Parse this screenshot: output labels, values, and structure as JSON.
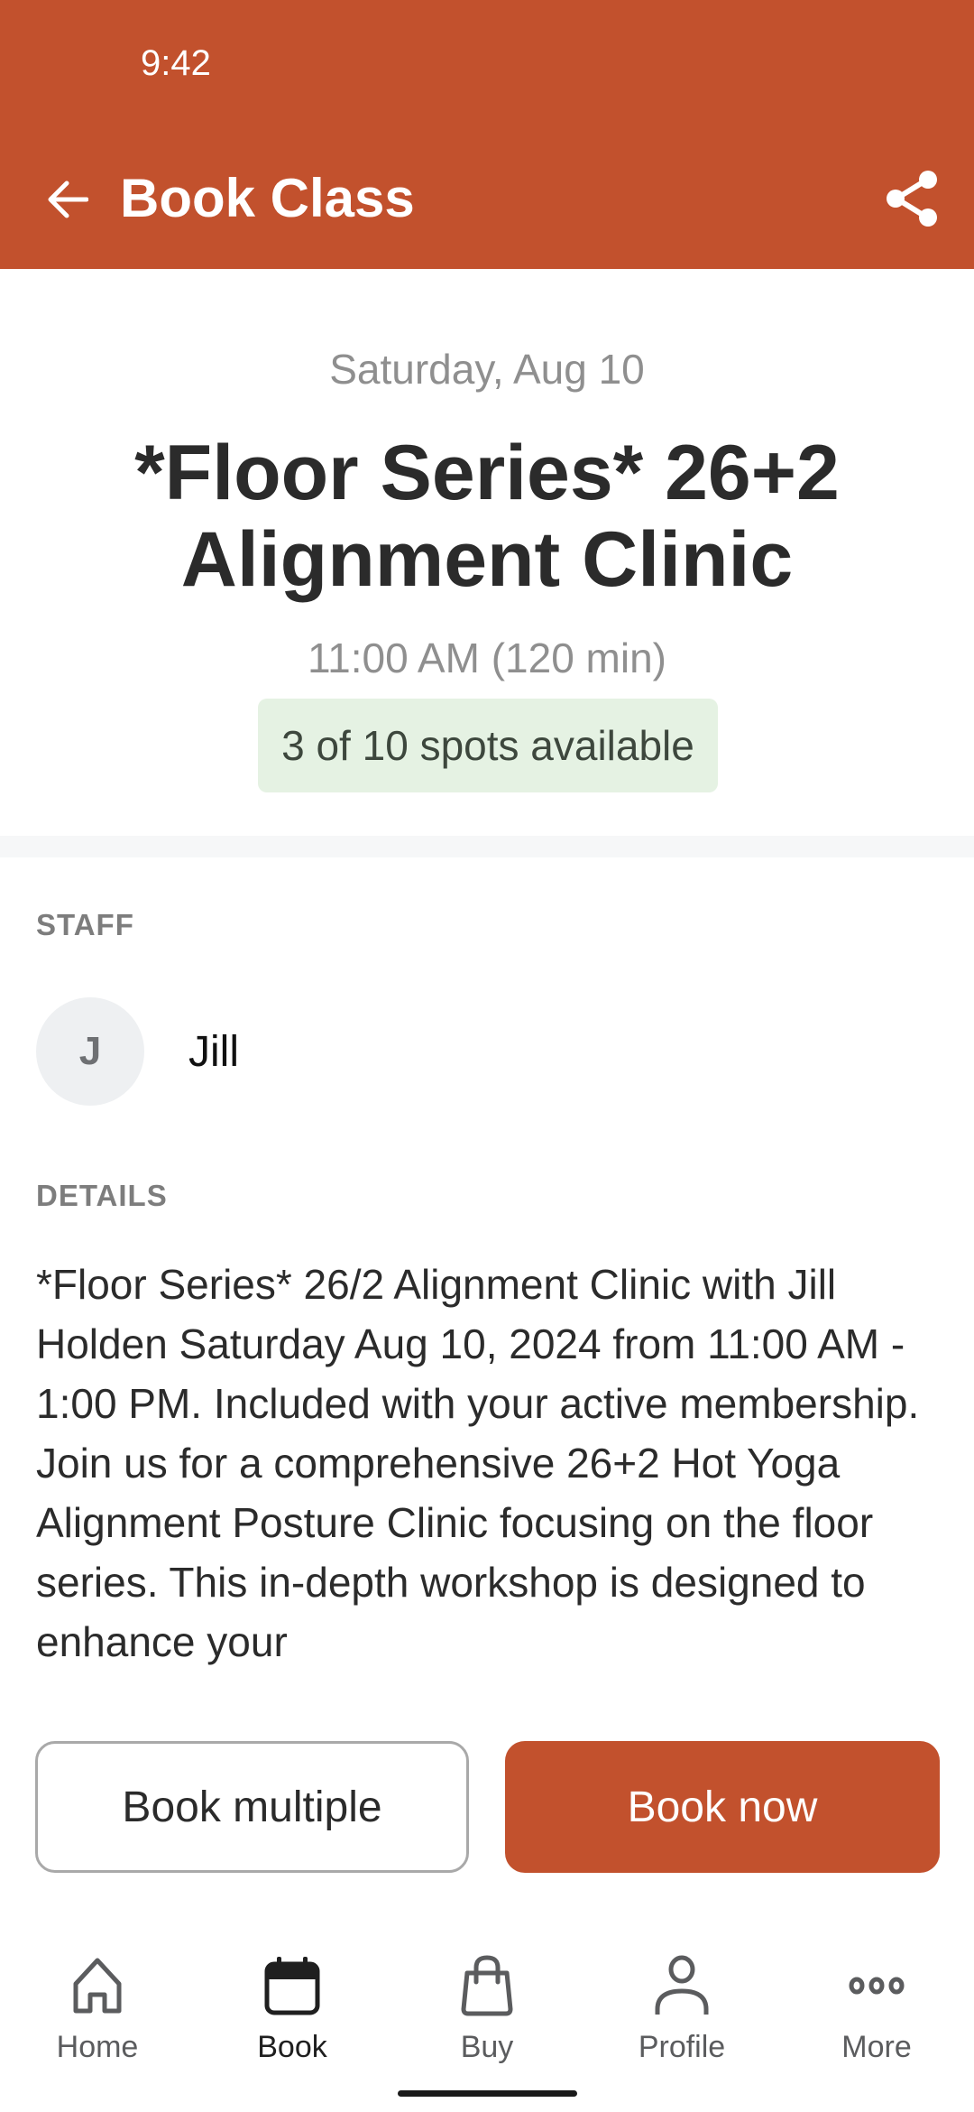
{
  "status_bar": {
    "time": "9:42"
  },
  "app_bar": {
    "title": "Book Class",
    "back_icon": "arrow-left-icon",
    "share_icon": "share-icon"
  },
  "class": {
    "date": "Saturday, Aug 10",
    "title": "*Floor Series* 26+2 Alignment Clinic",
    "time": "11:00 AM (120 min)",
    "spots": "3 of 10 spots available"
  },
  "staff": {
    "label": "STAFF",
    "initial": "J",
    "name": "Jill"
  },
  "details": {
    "label": "DETAILS",
    "text": "*Floor Series* 26/2 Alignment Clinic with Jill Holden Saturday Aug 10, 2024 from 11:00 AM - 1:00 PM. Included with your active membership. Join us for a comprehensive 26+2 Hot Yoga Alignment Posture Clinic focusing on the floor series. This in-depth workshop is designed to enhance your"
  },
  "actions": {
    "book_multiple": "Book multiple",
    "book_now": "Book now"
  },
  "tabs": [
    {
      "label": "Home",
      "icon": "home-icon",
      "active": false
    },
    {
      "label": "Book",
      "icon": "calendar-icon",
      "active": true
    },
    {
      "label": "Buy",
      "icon": "shopping-bag-icon",
      "active": false
    },
    {
      "label": "Profile",
      "icon": "person-icon",
      "active": false
    },
    {
      "label": "More",
      "icon": "more-dots-icon",
      "active": false
    }
  ],
  "colors": {
    "brand": "#c2512d",
    "spots_bg": "#e5f2e3",
    "muted_text": "#8f8f8f"
  }
}
